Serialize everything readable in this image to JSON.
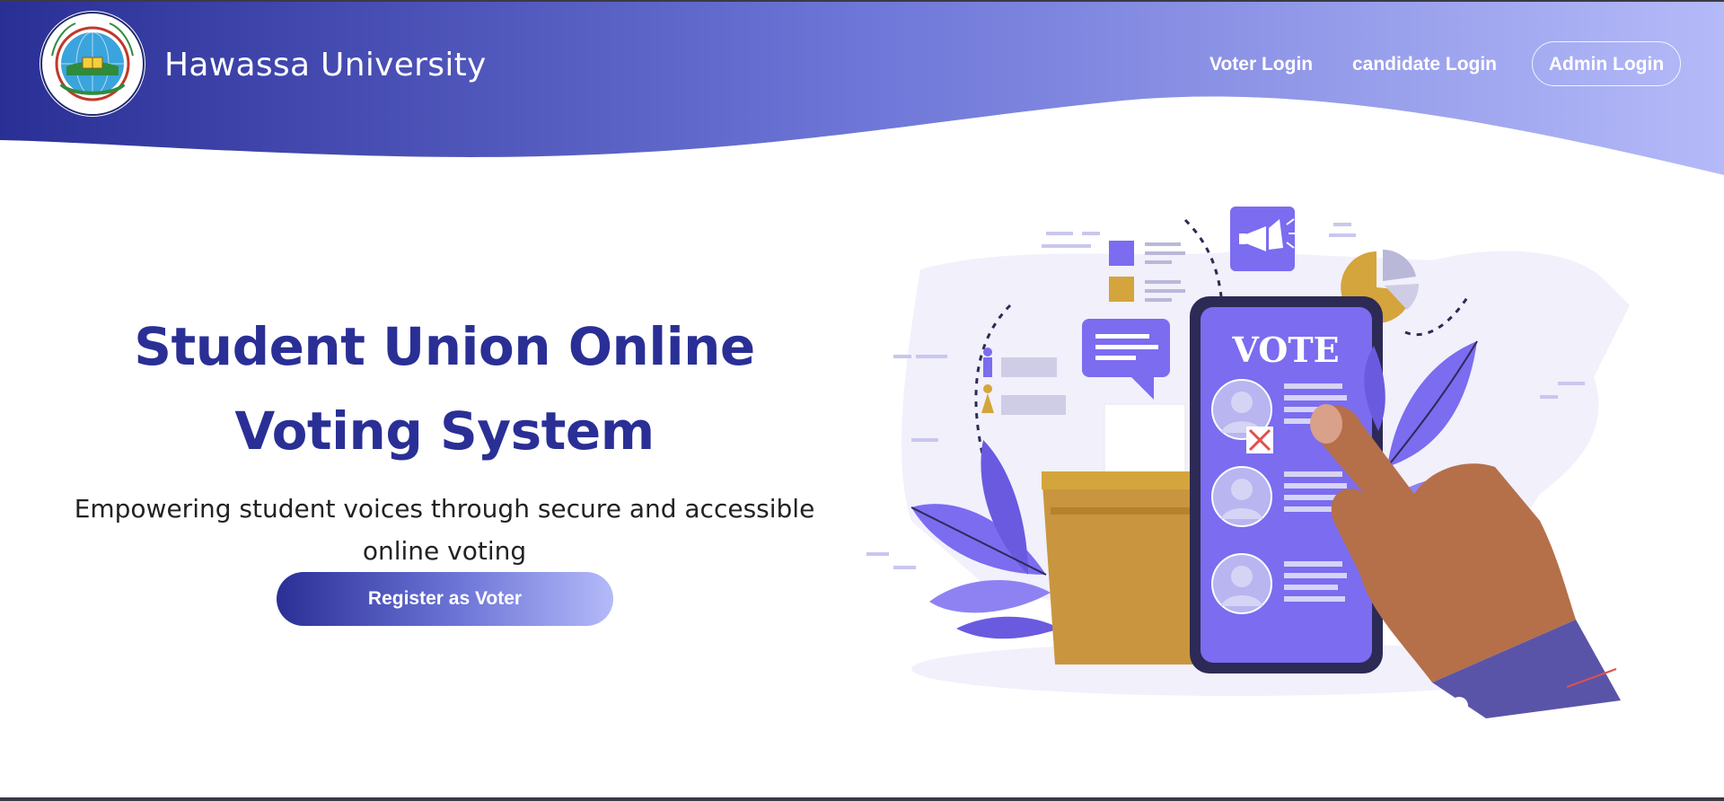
{
  "header": {
    "brand_name": "Hawassa University",
    "logo_text": "HAWASSA UNIVERSITY",
    "nav": {
      "voter_login": "Voter Login",
      "candidate_login": "candidate Login",
      "admin_login": "Admin Login"
    },
    "gradient_start": "#2a2f96",
    "gradient_end": "#b4baf8"
  },
  "hero": {
    "title": "Student Union Online Voting System",
    "subtitle": "Empowering student voices through secure and accessible online voting",
    "cta_label": "Register as Voter"
  },
  "illustration": {
    "phone_heading": "VOTE",
    "icons": [
      "megaphone-icon",
      "pie-chart-icon",
      "chat-bubble-icon",
      "ballot-box-icon",
      "hand-icon"
    ]
  },
  "colors": {
    "title": "#2a2f96",
    "accent_purple": "#7b6cf0",
    "gold": "#d4a53c"
  }
}
